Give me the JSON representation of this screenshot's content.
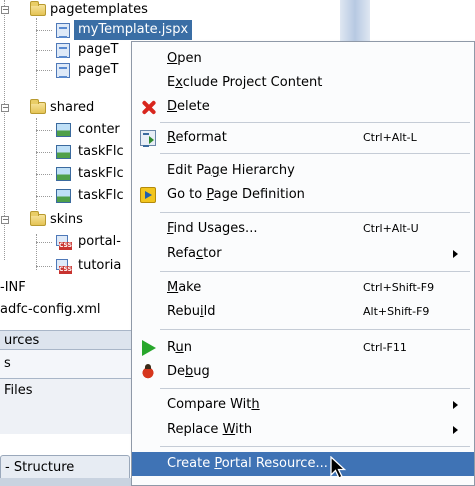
{
  "tree": {
    "items": [
      {
        "label": "pagetemplates",
        "kind": "folder"
      },
      {
        "label": "myTemplate.jspx",
        "kind": "file",
        "selected": true
      },
      {
        "label": "pageT",
        "kind": "file"
      },
      {
        "label": "pageT",
        "kind": "file"
      },
      {
        "label": "shared",
        "kind": "folder"
      },
      {
        "label": "conter",
        "kind": "image"
      },
      {
        "label": "taskFlc",
        "kind": "image"
      },
      {
        "label": "taskFlc",
        "kind": "image"
      },
      {
        "label": "taskFlc",
        "kind": "image"
      },
      {
        "label": "skins",
        "kind": "folder"
      },
      {
        "label": "portal-",
        "kind": "css"
      },
      {
        "label": "tutoria",
        "kind": "css"
      },
      {
        "label": "-INF",
        "kind": "text"
      },
      {
        "label": "adfc-config.xml",
        "kind": "text"
      }
    ],
    "panels": {
      "resources_label": "urces",
      "resources_value": "s",
      "files_label": "Files",
      "structure_tab": "- Structure"
    }
  },
  "menu": {
    "items": [
      {
        "label": "Open",
        "mnemonic": "O",
        "shortcut": "",
        "icon": "",
        "submenu": false
      },
      {
        "label": "Exclude Project Content",
        "mnemonic": "x",
        "shortcut": "",
        "icon": "",
        "submenu": false
      },
      {
        "label": "Delete",
        "mnemonic": "D",
        "shortcut": "",
        "icon": "delete-x-icon",
        "submenu": false
      },
      {
        "label": "Reformat",
        "mnemonic": "R",
        "shortcut": "Ctrl+Alt-L",
        "icon": "reformat-icon",
        "submenu": false
      },
      {
        "label": "Edit Page Hierarchy",
        "mnemonic": "g",
        "shortcut": "",
        "icon": "",
        "submenu": false
      },
      {
        "label": "Go to Page Definition",
        "mnemonic": "P",
        "shortcut": "",
        "icon": "go-to-definition-icon",
        "submenu": false
      },
      {
        "label": "Find Usages...",
        "mnemonic": "F",
        "shortcut": "Ctrl+Alt-U",
        "icon": "",
        "submenu": false
      },
      {
        "label": "Refactor",
        "mnemonic": "c",
        "shortcut": "",
        "icon": "",
        "submenu": true
      },
      {
        "label": "Make",
        "mnemonic": "M",
        "shortcut": "Ctrl+Shift-F9",
        "icon": "",
        "submenu": false
      },
      {
        "label": "Rebuild",
        "mnemonic": "i",
        "shortcut": "Alt+Shift-F9",
        "icon": "",
        "submenu": false
      },
      {
        "label": "Run",
        "mnemonic": "u",
        "shortcut": "Ctrl-F11",
        "icon": "run-icon",
        "submenu": false
      },
      {
        "label": "Debug",
        "mnemonic": "b",
        "shortcut": "",
        "icon": "debug-bug-icon",
        "submenu": false
      },
      {
        "label": "Compare With",
        "mnemonic": "h",
        "shortcut": "",
        "icon": "",
        "submenu": true
      },
      {
        "label": "Replace With",
        "mnemonic": "W",
        "shortcut": "",
        "icon": "",
        "submenu": true
      },
      {
        "label": "Create Portal Resource...",
        "mnemonic": "P",
        "shortcut": "",
        "icon": "",
        "submenu": false,
        "highlighted": true
      }
    ]
  }
}
